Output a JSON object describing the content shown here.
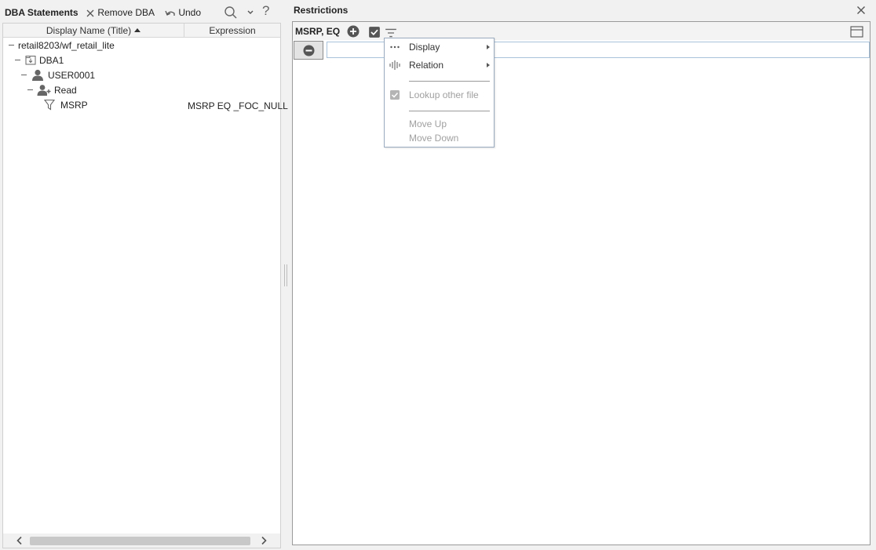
{
  "left": {
    "title": "DBA Statements",
    "remove_label": "Remove DBA",
    "undo_label": "Undo",
    "help_label": "?",
    "columns": {
      "name": "Display Name (Title)",
      "expression": "Expression"
    },
    "tree": [
      {
        "label": "retail8203/wf_retail_lite",
        "icon": "none",
        "expression": ""
      },
      {
        "label": "DBA1",
        "icon": "dba-file-icon",
        "expression": ""
      },
      {
        "label": "USER0001",
        "icon": "user-icon",
        "expression": ""
      },
      {
        "label": "Read",
        "icon": "user-access-icon",
        "expression": ""
      },
      {
        "label": "MSRP",
        "icon": "filter-icon",
        "expression": "MSRP EQ _FOC_NULL"
      }
    ]
  },
  "right": {
    "title": "Restrictions",
    "restriction_label": "MSRP, EQ",
    "value_input": {
      "value": "",
      "placeholder": ""
    }
  },
  "context_menu": {
    "items": [
      {
        "label": "Display",
        "icon": "more-dots-icon",
        "submenu": true,
        "enabled": true
      },
      {
        "label": "Relation",
        "icon": "relation-icon",
        "submenu": true,
        "enabled": true
      },
      {
        "label": "Lookup other file",
        "icon": "checkbox-checked-icon",
        "submenu": false,
        "enabled": false
      },
      {
        "label": "Move Up",
        "icon": "none",
        "submenu": false,
        "enabled": false
      },
      {
        "label": "Move Down",
        "icon": "none",
        "submenu": false,
        "enabled": false
      }
    ]
  },
  "colors": {
    "accent_border": "#a9c2dc",
    "menu_border": "#9aaabf",
    "icon_gray": "#555555"
  }
}
